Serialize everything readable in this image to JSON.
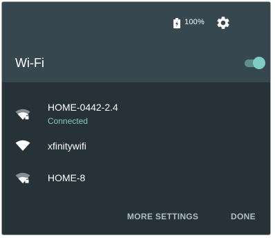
{
  "status_bar": {
    "battery_icon": "battery-charging-icon",
    "battery_text": "100%",
    "settings_icon": "gear-icon"
  },
  "header": {
    "title": "Wi-Fi",
    "toggle_state": "on"
  },
  "networks": [
    {
      "name": "HOME-0442-2.4",
      "status": "Connected",
      "icon": "wifi-lock-icon"
    },
    {
      "name": "xfinitywifi",
      "status": "",
      "icon": "wifi-icon"
    },
    {
      "name": "HOME-8",
      "status": "",
      "icon": "wifi-lock-icon"
    }
  ],
  "actions": {
    "more_settings": "MORE SETTINGS",
    "done": "DONE"
  },
  "colors": {
    "panel": "#263238",
    "header": "#37474f",
    "accent": "#80cbc4",
    "action_text": "#b0bec5"
  }
}
